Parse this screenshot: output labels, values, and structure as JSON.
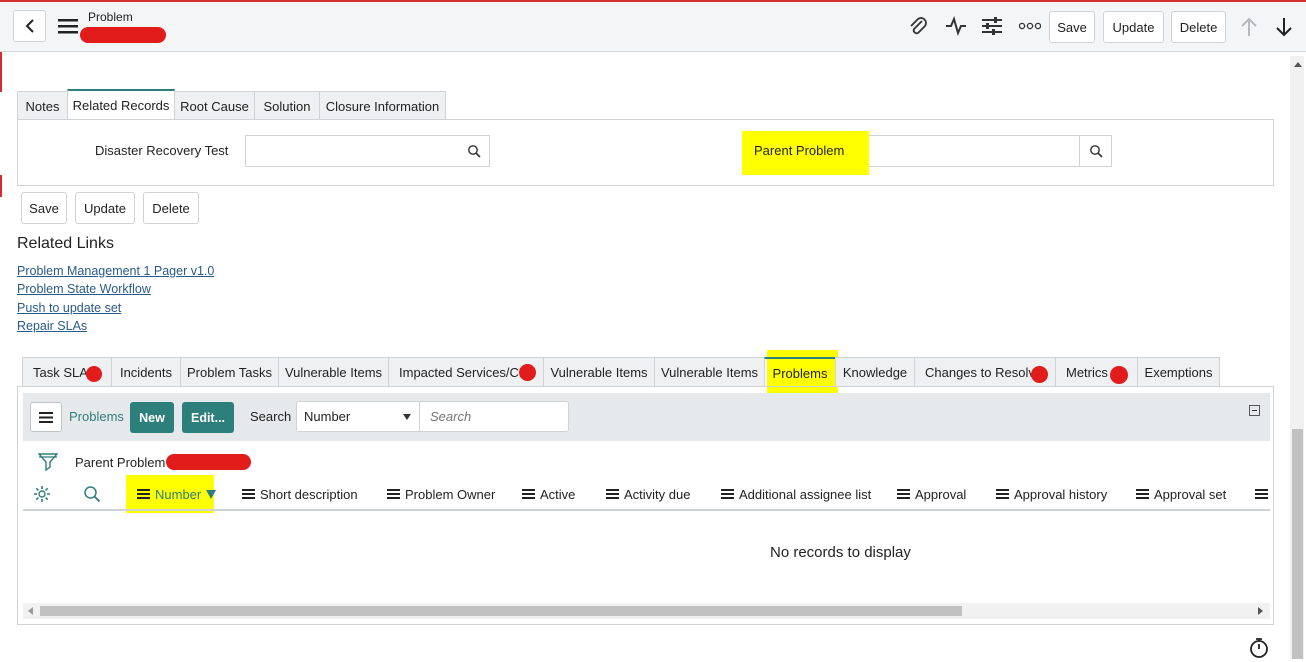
{
  "header": {
    "title": "Problem",
    "buttons": {
      "save": "Save",
      "update": "Update",
      "delete": "Delete"
    },
    "icons": [
      "back-icon",
      "hamburger-icon",
      "paperclip-icon",
      "activity-icon",
      "sliders-icon",
      "more-icon",
      "arrow-up-icon",
      "arrow-down-icon"
    ]
  },
  "form": {
    "tabs": [
      "Notes",
      "Related Records",
      "Root Cause",
      "Solution",
      "Closure Information"
    ],
    "active_tab": "Related Records",
    "fields": {
      "disaster_recovery_test": {
        "label": "Disaster Recovery Test",
        "value": ""
      },
      "parent_problem": {
        "label": "Parent Problem",
        "value": ""
      }
    },
    "buttons": {
      "save": "Save",
      "update": "Update",
      "delete": "Delete"
    }
  },
  "related_links": {
    "heading": "Related Links",
    "links": [
      "Problem Management 1 Pager v1.0",
      "Problem State Workflow",
      "Push to update set",
      "Repair SLAs"
    ]
  },
  "related_lists": {
    "tabs": [
      "Task SLAs",
      "Incidents",
      "Problem Tasks",
      "Vulnerable Items",
      "Impacted Services/CIs",
      "Vulnerable Items",
      "Vulnerable Items",
      "Problems",
      "Knowledge",
      "Changes to Resolve",
      "Metrics",
      "Exemptions"
    ],
    "active_tab": "Problems",
    "toolbar": {
      "list_title": "Problems",
      "new_label": "New",
      "edit_label": "Edit...",
      "search_label": "Search",
      "search_field": "Number",
      "search_placeholder": "Search"
    },
    "filter_text": "Parent Problem",
    "columns": [
      "Number",
      "Short description",
      "Problem Owner",
      "Active",
      "Activity due",
      "Additional assignee list",
      "Approval",
      "Approval history",
      "Approval set"
    ],
    "sorted_column": "Number",
    "empty_message": "No records to display"
  },
  "colors": {
    "accent": "#2d7f7b",
    "highlight": "#ffff00",
    "redaction": "#e21b1b",
    "link": "#2a5a8a"
  }
}
